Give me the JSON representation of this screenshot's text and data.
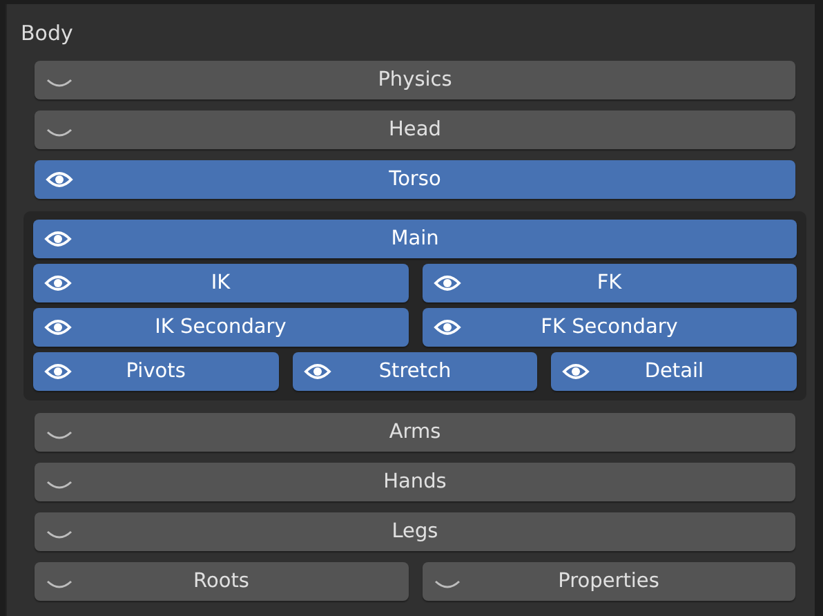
{
  "panel": {
    "title": "Body",
    "sections": [
      {
        "kind": "row",
        "toggles": [
          {
            "label": "Physics",
            "on": false
          }
        ]
      },
      {
        "kind": "row",
        "toggles": [
          {
            "label": "Head",
            "on": false
          }
        ]
      },
      {
        "kind": "row",
        "toggles": [
          {
            "label": "Torso",
            "on": true
          }
        ]
      },
      {
        "kind": "group",
        "rows": [
          [
            {
              "label": "Main",
              "on": true
            }
          ],
          [
            {
              "label": "IK",
              "on": true
            },
            {
              "label": "FK",
              "on": true
            }
          ],
          [
            {
              "label": "IK Secondary",
              "on": true
            },
            {
              "label": "FK Secondary",
              "on": true
            }
          ],
          [
            {
              "label": "Pivots",
              "on": true
            },
            {
              "label": "Stretch",
              "on": true
            },
            {
              "label": "Detail",
              "on": true
            }
          ]
        ]
      },
      {
        "kind": "row",
        "toggles": [
          {
            "label": "Arms",
            "on": false
          }
        ]
      },
      {
        "kind": "row",
        "toggles": [
          {
            "label": "Hands",
            "on": false
          }
        ]
      },
      {
        "kind": "row",
        "toggles": [
          {
            "label": "Legs",
            "on": false
          }
        ]
      },
      {
        "kind": "row",
        "toggles": [
          {
            "label": "Roots",
            "on": false
          },
          {
            "label": "Properties",
            "on": false
          }
        ]
      }
    ]
  }
}
